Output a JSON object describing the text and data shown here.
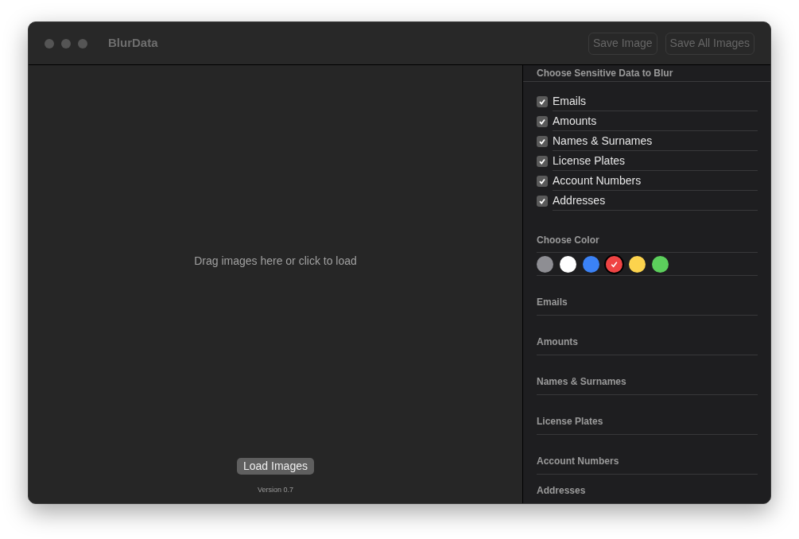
{
  "window": {
    "title": "BlurData"
  },
  "toolbar_buttons": [
    {
      "label": "Save Image",
      "disabled": true
    },
    {
      "label": "Save All Images",
      "disabled": true
    }
  ],
  "drop_area": {
    "hint": "Drag images here or click to load",
    "button": "Load Images",
    "version": "Version 0.7"
  },
  "sidebar": {
    "heading": "Choose Sensitive Data to Blur",
    "options": [
      {
        "label": "Emails",
        "checked": true
      },
      {
        "label": "Amounts",
        "checked": true
      },
      {
        "label": "Names & Surnames",
        "checked": true
      },
      {
        "label": "License Plates",
        "checked": true
      },
      {
        "label": "Account Numbers",
        "checked": true
      },
      {
        "label": "Addresses",
        "checked": true
      }
    ],
    "color_heading": "Choose Color",
    "colors": [
      {
        "color": "#8e8e93",
        "selected": false
      },
      {
        "color": "#ffffff",
        "selected": false
      },
      {
        "color": "#3b82f6",
        "selected": false
      },
      {
        "color": "#ef4444",
        "selected": true
      },
      {
        "color": "#fcd34d",
        "selected": false
      },
      {
        "color": "#5ccf5c",
        "selected": false
      }
    ],
    "sections": [
      "Emails",
      "Amounts",
      "Names & Surnames",
      "License Plates",
      "Account Numbers",
      "Addresses"
    ]
  }
}
